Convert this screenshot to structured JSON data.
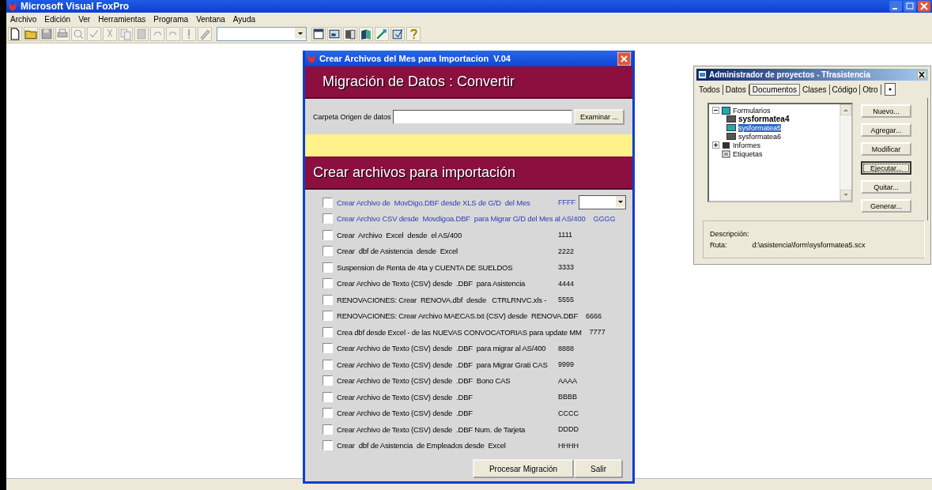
{
  "window": {
    "title": "Microsoft Visual FoxPro"
  },
  "menu": [
    "Archivo",
    "Edición",
    "Ver",
    "Herramientas",
    "Programa",
    "Ventana",
    "Ayuda"
  ],
  "dialog": {
    "title": "Crear Archivos del Mes para Importacion  V.04",
    "heading": "Migración de Datos : Convertir",
    "folder_label": "Carpeta Origen de datos",
    "browse_button": "Examinar ...",
    "section_heading": "Crear archivos para importación",
    "options": [
      {
        "label": "Crear Archivo de  MovDigo.DBF desde XLS de G/D  del Mes",
        "code": "FFFF",
        "checked": false,
        "highlighted": true,
        "kind": "dropdown"
      },
      {
        "label": "Crear Archivo CSV desde  Movdigoa.DBF  para Migrar G/D del Mes al AS/400",
        "code": "GGGG",
        "checked": false,
        "highlighted": true,
        "kind": "plain"
      },
      {
        "label": "Crear  Archivo  Excel  desde  el AS/400",
        "code": "1111",
        "checked": false,
        "highlighted": false,
        "kind": "plain"
      },
      {
        "label": "Crear  dbf de Asistencia  desde  Excel",
        "code": "2222",
        "checked": false,
        "highlighted": false,
        "kind": "plain"
      },
      {
        "label": "Suspension de Renta de 4ta y CUENTA DE SUELDOS",
        "code": "3333",
        "checked": false,
        "highlighted": false,
        "kind": "plain"
      },
      {
        "label": "Crear Archivo de Texto (CSV) desde  .DBF  para Asistencia",
        "code": "4444",
        "checked": false,
        "highlighted": false,
        "kind": "plain"
      },
      {
        "label": "RENOVACIONES: Crear  RENOVA.dbf  desde   CTRLRNVC.xls -",
        "code": "5555",
        "checked": false,
        "highlighted": false,
        "kind": "plain"
      },
      {
        "label": "RENOVACIONES: Crear Archivo MAECAS.txt (CSV) desde  RENOVA.DBF",
        "code": "6666",
        "checked": false,
        "highlighted": false,
        "kind": "plain"
      },
      {
        "label": "Crea dbf desde Excel - de las NUEVAS CONVOCATORIAS para update MM",
        "code": "7777",
        "checked": false,
        "highlighted": false,
        "kind": "plain"
      },
      {
        "label": "Crear Archivo de Texto (CSV) desde  .DBF  para migrar al AS/400",
        "code": "8888",
        "checked": false,
        "highlighted": false,
        "kind": "plain"
      },
      {
        "label": "Crear Archivo de Texto (CSV) desde  .DBF  para Migrar Grati CAS",
        "code": "9999",
        "checked": false,
        "highlighted": false,
        "kind": "plain"
      },
      {
        "label": "Crear Archivo de Texto (CSV) desde  .DBF  Bono CAS",
        "code": "AAAA",
        "checked": false,
        "highlighted": false,
        "kind": "plain"
      },
      {
        "label": "Crear Archivo de Texto (CSV) desde  .DBF",
        "code": "BBBB",
        "checked": false,
        "highlighted": false,
        "kind": "plain"
      },
      {
        "label": "Crear Archivo de Texto (CSV) desde  .DBF",
        "code": "CCCC",
        "checked": false,
        "highlighted": false,
        "kind": "plain"
      },
      {
        "label": "Crear Archivo de Texto (CSV) desde  .DBF Num. de Tarjeta",
        "code": "DDDD",
        "checked": false,
        "highlighted": false,
        "kind": "plain"
      },
      {
        "label": "Crear  dbf de Asistencia  de Empleados desde  Excel",
        "code": "HHHH",
        "checked": false,
        "highlighted": false,
        "kind": "plain"
      }
    ],
    "buttons": [
      "Procesar Migración",
      "Salir"
    ]
  },
  "project_manager": {
    "title": "Administrador de proyectos - Tfrasistencia",
    "tabs": [
      {
        "label": "Todos",
        "selected": false
      },
      {
        "label": "Datos",
        "selected": false
      },
      {
        "label": "Documentos",
        "selected": true
      },
      {
        "label": "Clases",
        "selected": false
      },
      {
        "label": "Código",
        "selected": false
      },
      {
        "label": "Otro",
        "selected": false
      }
    ],
    "tree": [
      {
        "label": "Formularios",
        "expanded": true,
        "children": [
          {
            "label": "sysformatea4",
            "selected": false,
            "bold": true
          },
          {
            "label": "sysformatea5",
            "selected": true,
            "bold": false
          },
          {
            "label": "sysformatea6",
            "selected": false,
            "bold": false
          }
        ]
      },
      {
        "label": "Informes",
        "expanded": false
      },
      {
        "label": "Etiquetas"
      }
    ],
    "buttons": [
      {
        "label": "Nuevo...",
        "focused": false
      },
      {
        "label": "Agregar...",
        "focused": false
      },
      {
        "label": "Modificar",
        "focused": false
      },
      {
        "label": "Ejecutar...",
        "focused": true
      },
      {
        "label": "Quitar...",
        "focused": false
      },
      {
        "label": "Generar...",
        "focused": false
      }
    ],
    "description_label": "Descripción:",
    "path_label": "Ruta:",
    "path": "d:\\asistencia\\form\\sysformatea5.scx"
  }
}
